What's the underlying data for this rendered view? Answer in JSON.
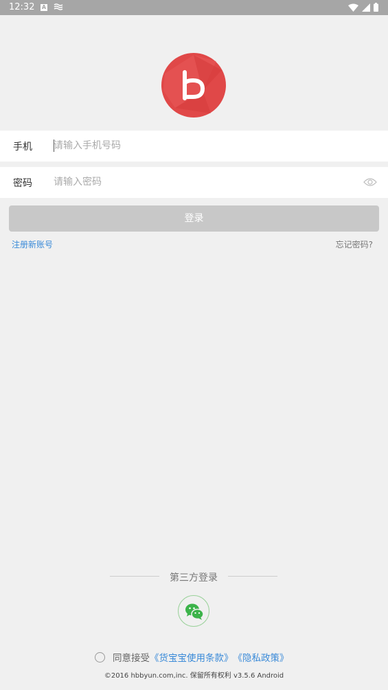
{
  "status_bar": {
    "time": "12:32",
    "icons": [
      "a-icon",
      "wave-icon",
      "wifi-icon",
      "signal-icon",
      "battery-icon"
    ]
  },
  "colors": {
    "logo_red": "#e04848",
    "link_blue": "#3a8ad8",
    "button_disabled": "#c8c8c8",
    "wechat_green": "#3cb34a"
  },
  "form": {
    "phone_label": "手机",
    "phone_placeholder": "请输入手机号码",
    "password_label": "密码",
    "password_placeholder": "请输入密码",
    "login_label": "登录"
  },
  "links": {
    "register": "注册新账号",
    "forgot": "忘记密码?"
  },
  "third_party": {
    "title": "第三方登录"
  },
  "agreement": {
    "prefix": "同意接受",
    "terms": "《货宝宝使用条款》",
    "privacy": "《隐私政策》"
  },
  "footer": {
    "copyright": "©2016 hbbyun.com,inc. 保留所有权利  v3.5.6 Android"
  }
}
